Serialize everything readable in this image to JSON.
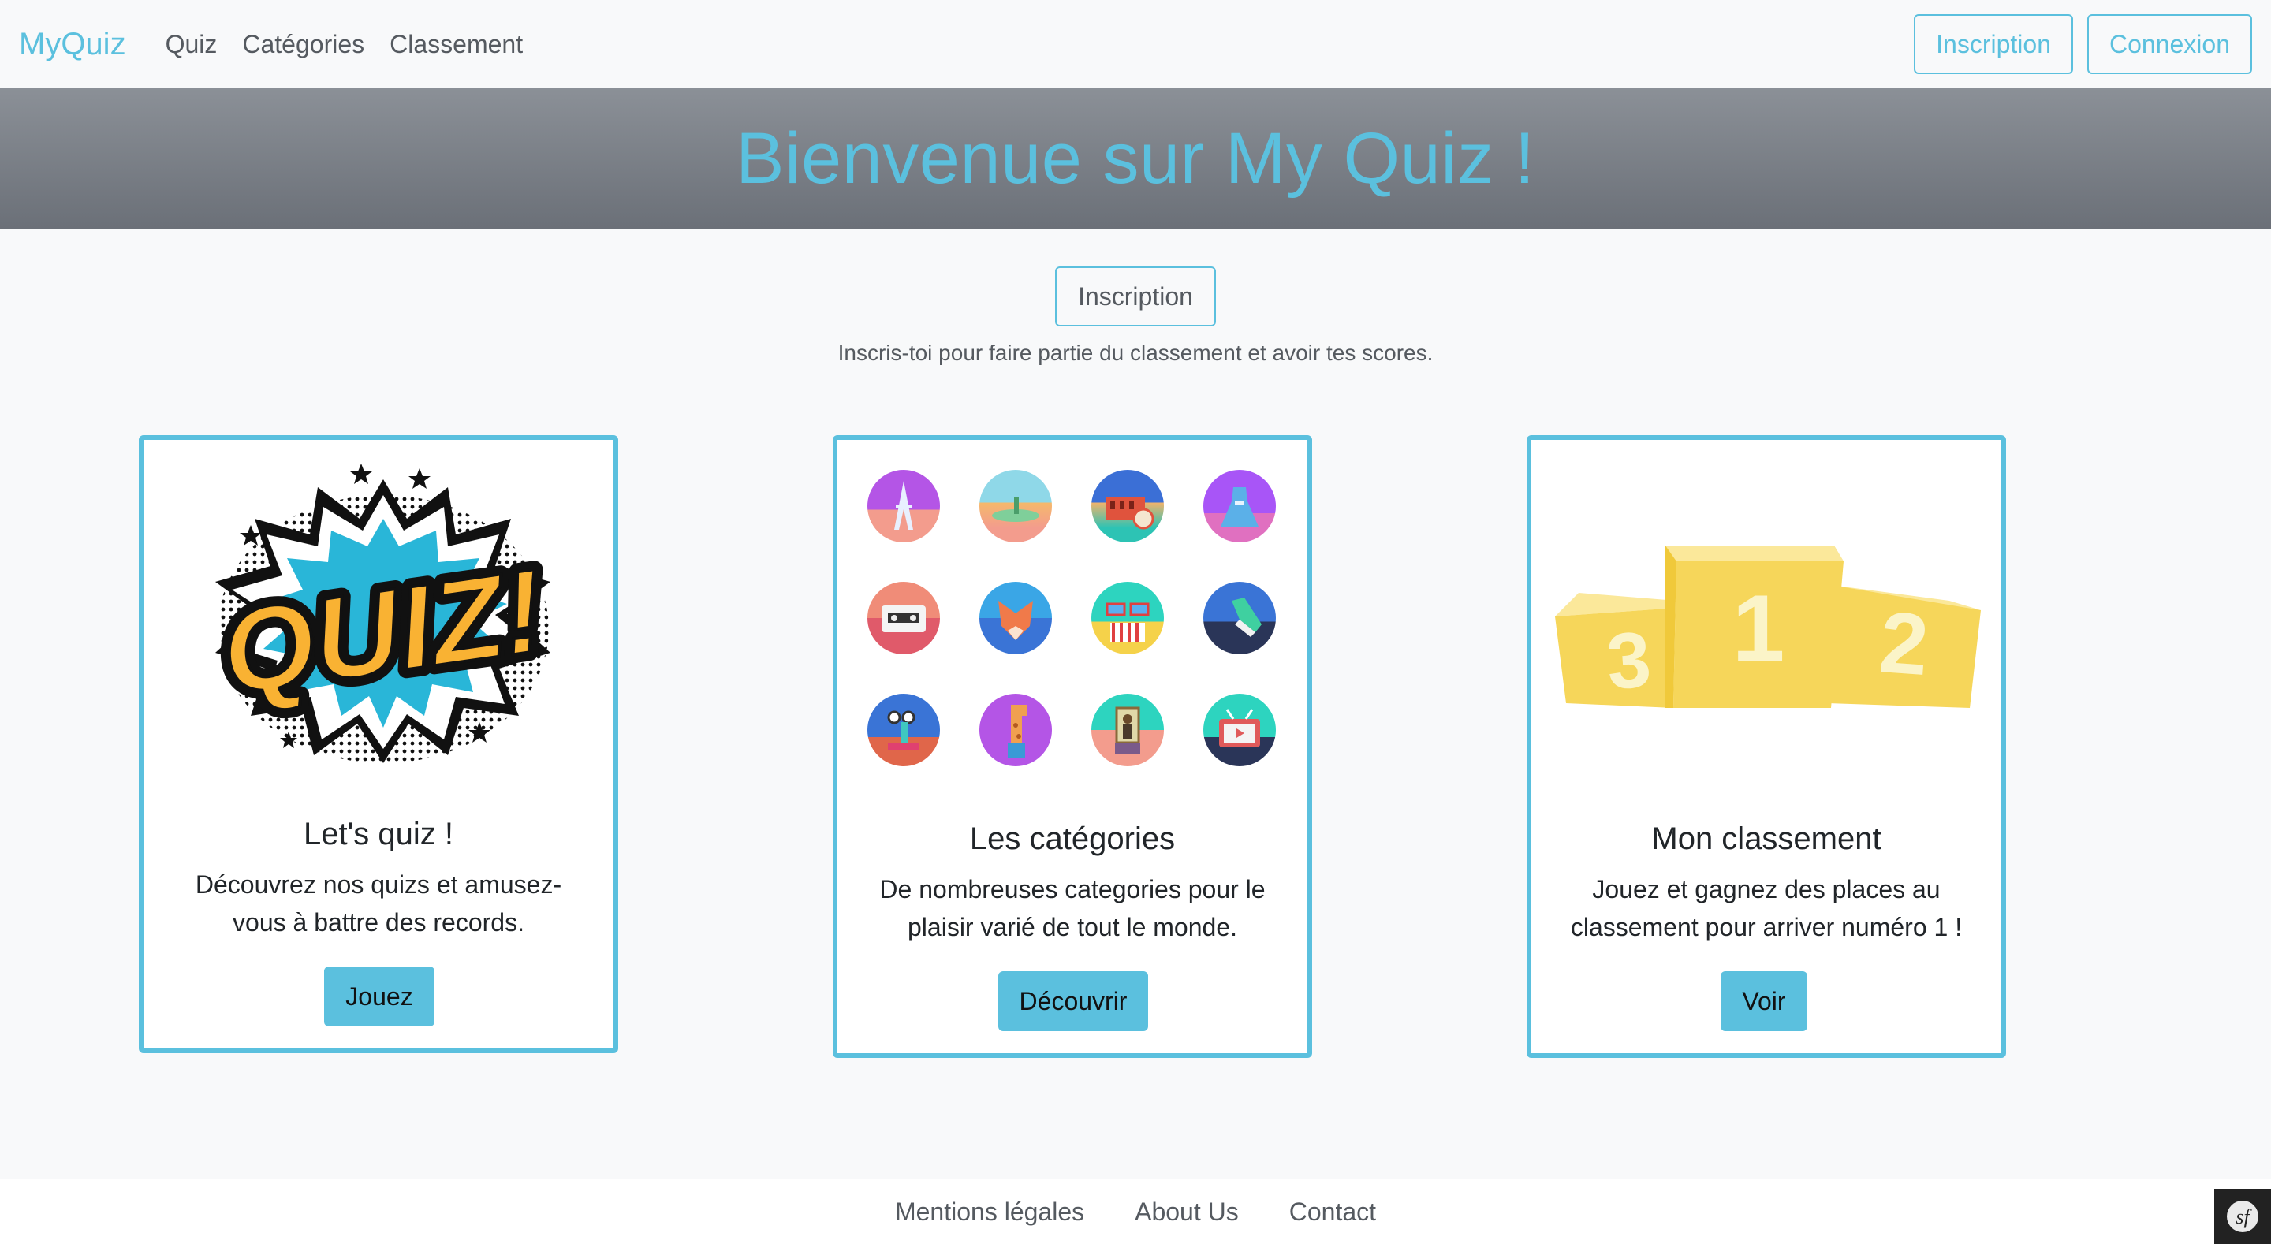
{
  "navbar": {
    "brand": "MyQuiz",
    "links": [
      "Quiz",
      "Catégories",
      "Classement"
    ],
    "signup": "Inscription",
    "login": "Connexion"
  },
  "hero": {
    "title": "Bienvenue sur My Quiz !"
  },
  "cta": {
    "button": "Inscription",
    "text": "Inscris-toi pour faire partie du classement et avoir tes scores."
  },
  "cards": [
    {
      "title": "Let's quiz !",
      "text_line1": "Découvrez nos quizs et amusez-",
      "text_line2": "vous à battre des records.",
      "button": "Jouez",
      "image_text": "QUIZ!"
    },
    {
      "title": "Les catégories",
      "text_line1": "De nombreuses categories pour le",
      "text_line2": "plaisir varié de tout le monde.",
      "button": "Découvrir"
    },
    {
      "title": "Mon classement",
      "text_line1": "Jouez et gagnez des places au",
      "text_line2": "classement pour arriver numéro 1 !",
      "button": "Voir",
      "podium": [
        "1",
        "2",
        "3"
      ]
    }
  ],
  "category_icons": [
    {
      "name": "eiffel-tower-icon",
      "color": "#a855f7"
    },
    {
      "name": "desert-icon",
      "color": "#7dd3e8"
    },
    {
      "name": "colosseum-icon",
      "color": "#3b82f6"
    },
    {
      "name": "dress-icon",
      "color": "#a855f7"
    },
    {
      "name": "cassette-icon",
      "color": "#f87171"
    },
    {
      "name": "fox-icon",
      "color": "#3b82f6"
    },
    {
      "name": "cinema-3d-icon",
      "color": "#2dd4bf"
    },
    {
      "name": "sneaker-icon",
      "color": "#1e3a8a"
    },
    {
      "name": "microscope-icon",
      "color": "#3b82f6"
    },
    {
      "name": "giraffe-icon",
      "color": "#a855f7"
    },
    {
      "name": "mona-lisa-icon",
      "color": "#2dd4bf"
    },
    {
      "name": "tv-icon",
      "color": "#2dd4bf"
    }
  ],
  "footer": {
    "links": [
      "Mentions légales",
      "About Us",
      "Contact"
    ]
  },
  "colors": {
    "accent": "#5bc0de",
    "podium": "#f6d65a"
  }
}
